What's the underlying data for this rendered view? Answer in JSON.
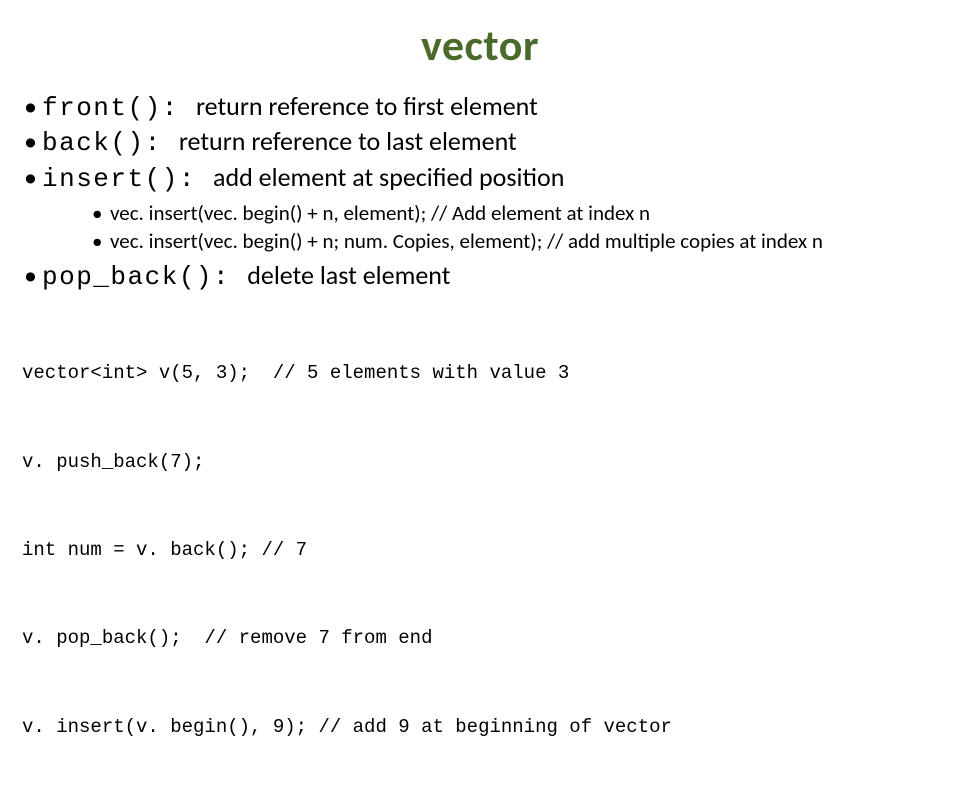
{
  "title": "vector",
  "bullets": {
    "b0": {
      "code": "front(): ",
      "desc": "return reference to first element"
    },
    "b1": {
      "code": "back(): ",
      "desc": "return reference to last element"
    },
    "b2": {
      "code": "insert(): ",
      "desc": "add element at specified position"
    },
    "b3": {
      "code": "pop_back(): ",
      "desc": "delete last element"
    }
  },
  "subs": {
    "s0": "vec. insert(vec. begin() + n, element); // Add element at index n",
    "s1": "vec. insert(vec. begin() + n; num. Copies, element); // add multiple copies at index n"
  },
  "code": {
    "l0": "vector<int> v(5, 3);  // 5 elements with value 3",
    "l1": "v. push_back(7);",
    "l2": "int num = v. back(); // 7",
    "l3": "v. pop_back();  // remove 7 from end",
    "l4": "v. insert(v. begin(), 9); // add 9 at beginning of vector"
  }
}
